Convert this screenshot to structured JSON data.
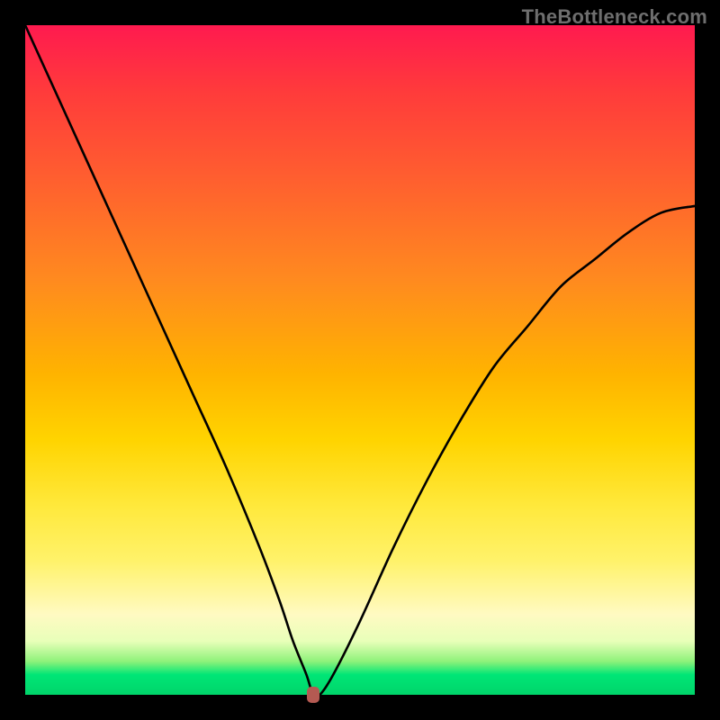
{
  "brand": {
    "watermark": "TheBottleneck.com"
  },
  "colors": {
    "bg": "#000000",
    "curve": "#000000",
    "dot": "#b45a52",
    "gradient_top": "#ff1a4f",
    "gradient_mid": "#ffd400",
    "gradient_bottom": "#00d46a"
  },
  "chart_data": {
    "type": "line",
    "title": "",
    "xlabel": "",
    "ylabel": "",
    "xlim": [
      0,
      100
    ],
    "ylim": [
      0,
      100
    ],
    "grid": false,
    "legend": false,
    "annotations": [
      {
        "name": "optimal-point",
        "x": 43,
        "y": 0
      }
    ],
    "series": [
      {
        "name": "bottleneck-curve",
        "x": [
          0,
          5,
          10,
          15,
          20,
          25,
          30,
          35,
          38,
          40,
          42,
          43,
          44,
          46,
          50,
          55,
          60,
          65,
          70,
          75,
          80,
          85,
          90,
          95,
          100
        ],
        "y": [
          100,
          89,
          78,
          67,
          56,
          45,
          34,
          22,
          14,
          8,
          3,
          0,
          0,
          3,
          11,
          22,
          32,
          41,
          49,
          55,
          61,
          65,
          69,
          72,
          73
        ]
      }
    ]
  }
}
